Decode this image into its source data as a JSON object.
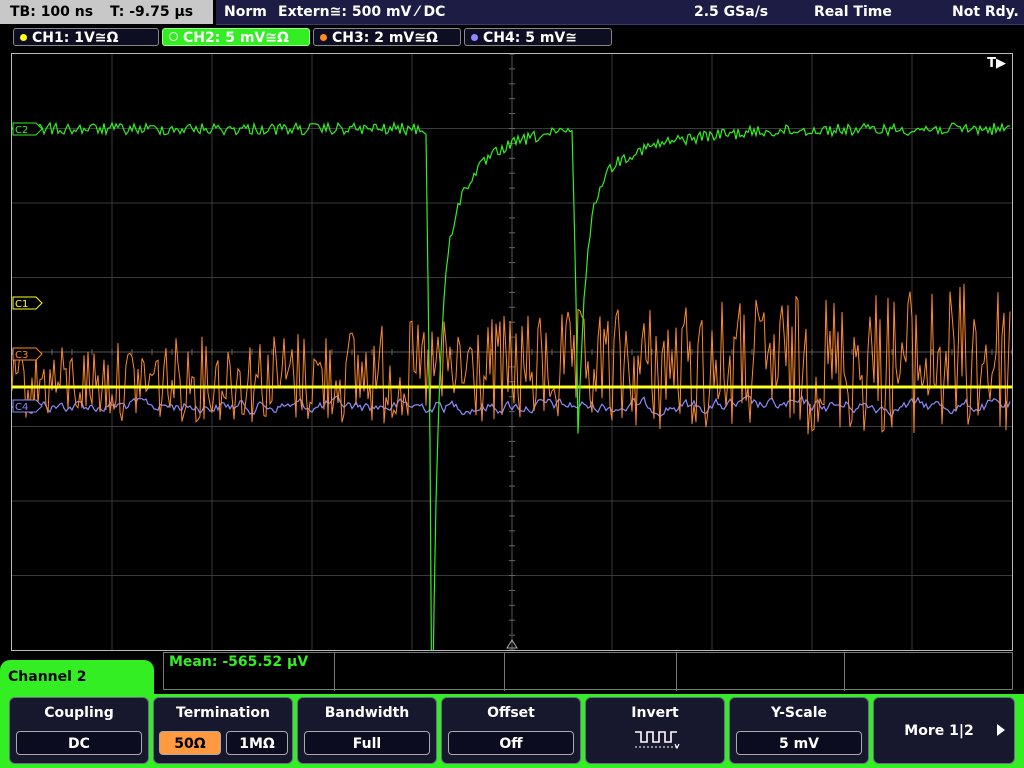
{
  "header": {
    "timebase": "TB: 100 ns",
    "trigger_time": "T: -9.75 µs",
    "mode": "Norm",
    "trigger_source": "Extern≅: 500 mV ⁄ DC",
    "sample_rate": "2.5 GSa/s",
    "acq_mode": "Real Time",
    "status": "Not Rdy."
  },
  "channels": [
    {
      "label": "CH1: 1V≅Ω",
      "color": "#ffff22"
    },
    {
      "label": "CH2: 5 mV≅Ω",
      "color": "#33ee22"
    },
    {
      "label": "CH3: 2 mV≅Ω",
      "color": "#ff8a2a"
    },
    {
      "label": "CH4: 5 mV≅",
      "color": "#8a8aff"
    }
  ],
  "markers": {
    "c1": "C1",
    "c2": "C2",
    "c3": "C3",
    "c4": "C4",
    "trigger": "T▶"
  },
  "measurement": {
    "mean": "Mean: -565.52 µV"
  },
  "menu": {
    "title": "Channel 2",
    "coupling": {
      "label": "Coupling",
      "value": "DC"
    },
    "termination": {
      "label": "Termination",
      "option_a": "50Ω",
      "option_b": "1MΩ"
    },
    "bandwidth": {
      "label": "Bandwidth",
      "value": "Full"
    },
    "offset": {
      "label": "Offset",
      "value": "Off"
    },
    "invert": {
      "label": "Invert",
      "icon": "invert-pulse-icon"
    },
    "yscale": {
      "label": "Y-Scale",
      "value": "5 mV"
    },
    "more": {
      "label": "More 1|2",
      "icon": "play-arrow-icon"
    }
  },
  "colors": {
    "grid": "#3a3a3a",
    "accent": "#33ee22",
    "selected": "#ff9a40"
  }
}
